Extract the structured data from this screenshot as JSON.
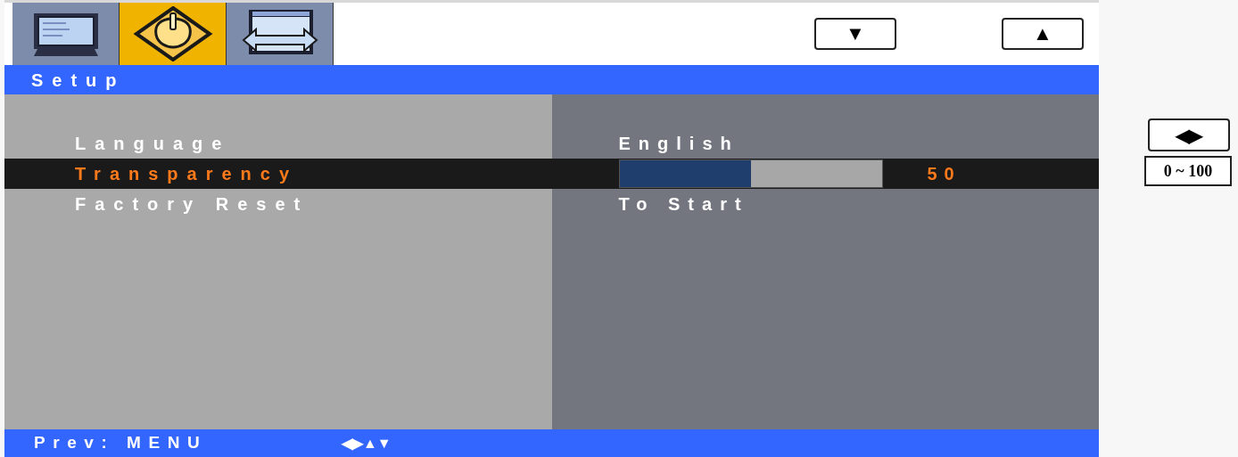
{
  "tabs": [
    {
      "kind": "monitor",
      "selected": false
    },
    {
      "kind": "setup",
      "selected": true
    },
    {
      "kind": "resize",
      "selected": false
    }
  ],
  "nav_buttons": [
    "▼",
    "▲"
  ],
  "title": "Setup",
  "items": [
    {
      "label": "Language",
      "kind": "text",
      "value": "English",
      "selected": false
    },
    {
      "label": "Transparency",
      "kind": "slider",
      "level": 0.5,
      "reading": "50",
      "selected": true
    },
    {
      "label": "Factory Reset",
      "kind": "text",
      "value": "To Start",
      "selected": false
    }
  ],
  "footer": {
    "hint": "Prev: MENU",
    "keys": "◀▶▲▼"
  },
  "side_hints": [
    {
      "kind": "key",
      "text": "◀▶"
    },
    {
      "kind": "range",
      "text": "0 ~ 100"
    }
  ]
}
